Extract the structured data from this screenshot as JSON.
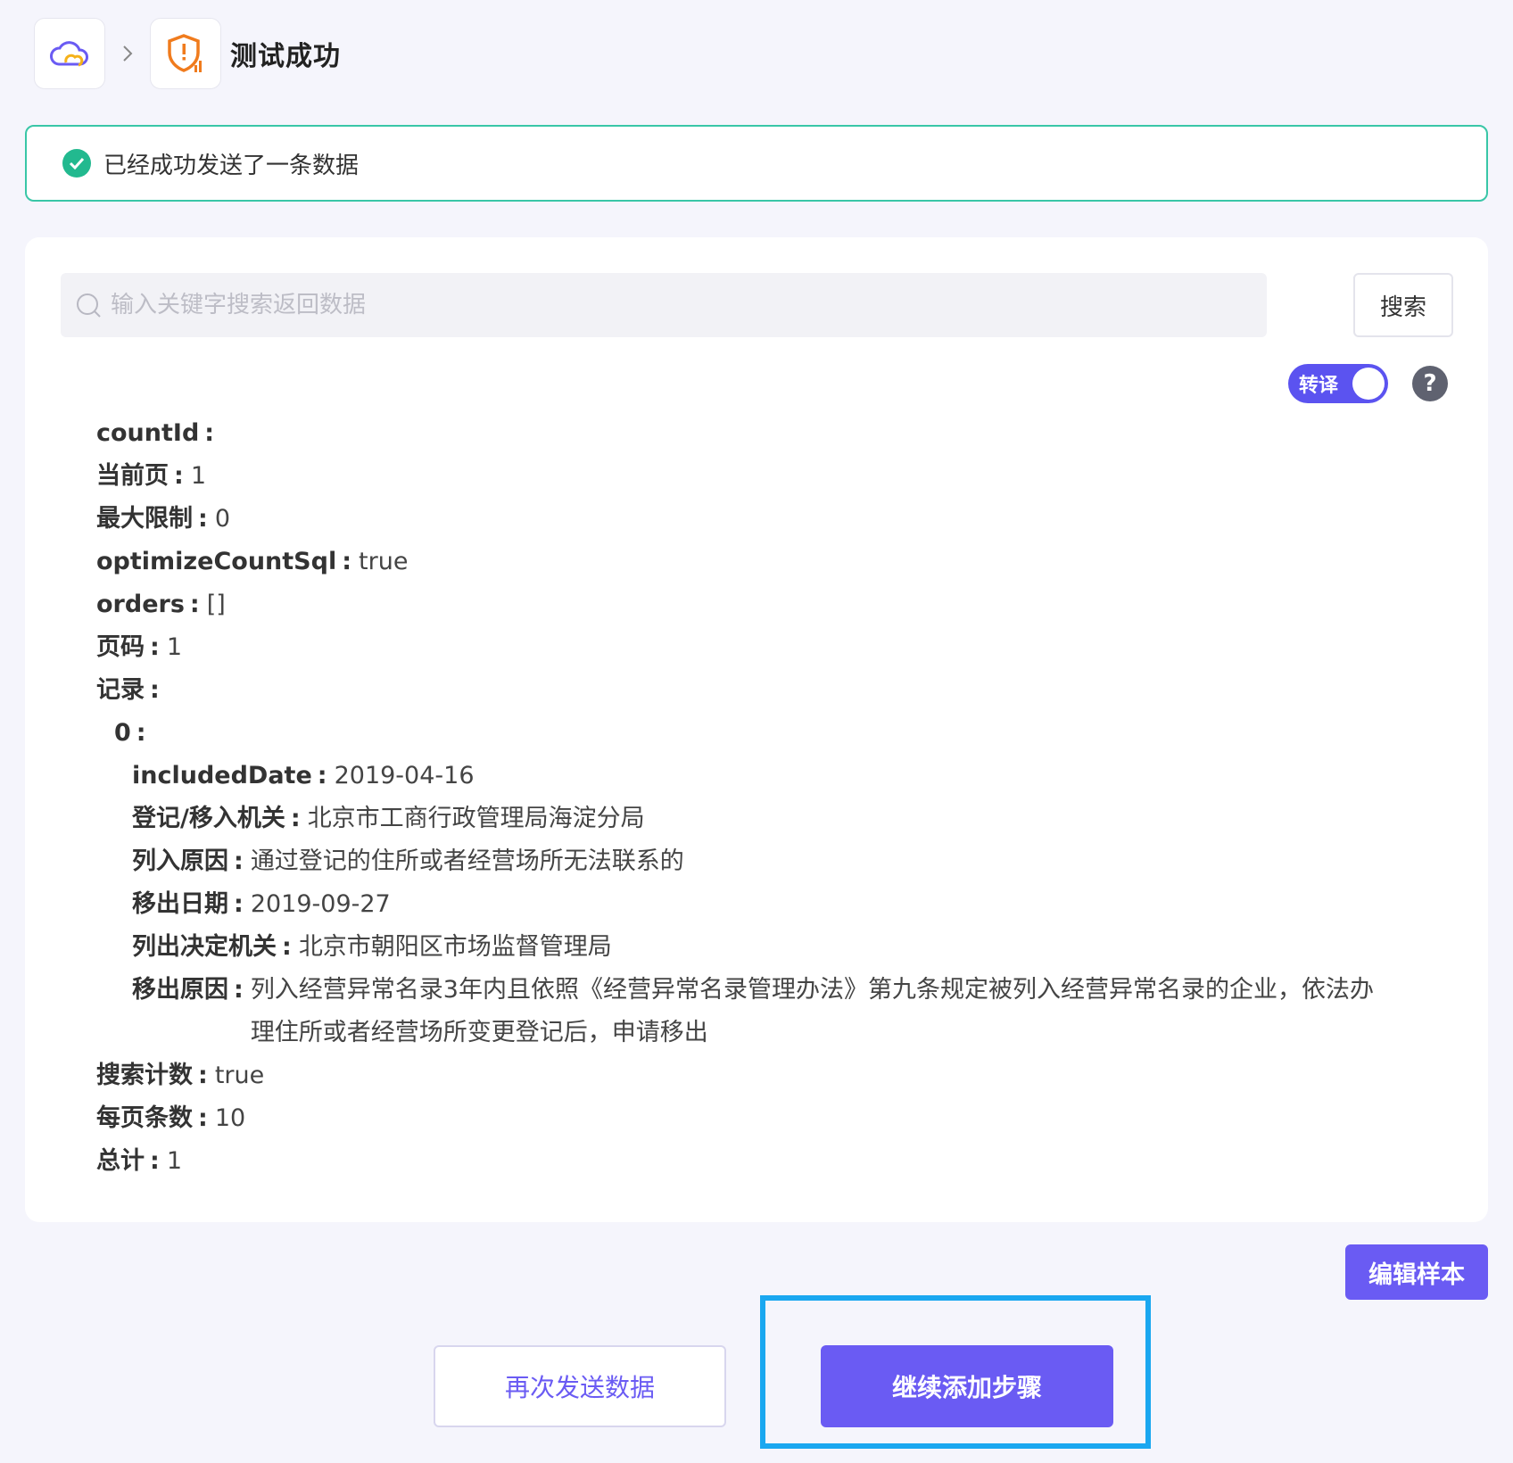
{
  "header": {
    "title": "测试成功",
    "app_icon": "cloud-icon",
    "step_icon": "shield-alert-icon",
    "separator_icon": "chevron-right-icon"
  },
  "alert": {
    "message": "已经成功发送了一条数据",
    "icon": "check-circle-icon"
  },
  "search": {
    "placeholder": "输入关键字搜索返回数据",
    "value": "",
    "button_label": "搜索"
  },
  "toggle": {
    "label": "转译",
    "on": true
  },
  "help": {
    "label": "?"
  },
  "fields": {
    "countId": {
      "key": "countId",
      "value": ""
    },
    "current": {
      "key": "当前页",
      "value": "1"
    },
    "maxLimit": {
      "key": "最大限制",
      "value": "0"
    },
    "optimizeCountSql": {
      "key": "optimizeCountSql",
      "value": "true"
    },
    "orders": {
      "key": "orders",
      "value": "[]"
    },
    "pageNum": {
      "key": "页码",
      "value": "1"
    },
    "records": {
      "key": "记录",
      "value": ""
    },
    "record0": {
      "key": "0",
      "value": ""
    },
    "includedDate": {
      "key": "includedDate",
      "value": "2019-04-16"
    },
    "regAuthority": {
      "key": "登记/移入机关",
      "value": "北京市工商行政管理局海淀分局"
    },
    "includeReason": {
      "key": "列入原因",
      "value": "通过登记的住所或者经营场所无法联系的"
    },
    "removeDate": {
      "key": "移出日期",
      "value": "2019-09-27"
    },
    "removeAuthority": {
      "key": "列出决定机关",
      "value": "北京市朝阳区市场监督管理局"
    },
    "removeReason": {
      "key": "移出原因",
      "value": "列入经营异常名录3年内且依照《经营异常名录管理办法》第九条规定被列入经营异常名录的企业，依法办理住所或者经营场所变更登记后，申请移出"
    },
    "searchCount": {
      "key": "搜索计数",
      "value": "true"
    },
    "pageSize": {
      "key": "每页条数",
      "value": "10"
    },
    "total": {
      "key": "总计",
      "value": "1"
    }
  },
  "actions": {
    "edit_sample": "编辑样本",
    "resend": "再次发送数据",
    "continue": "继续添加步骤"
  },
  "colors": {
    "accent": "#6a5bf3",
    "success": "#22b98f",
    "highlight": "#1aa7f0"
  }
}
